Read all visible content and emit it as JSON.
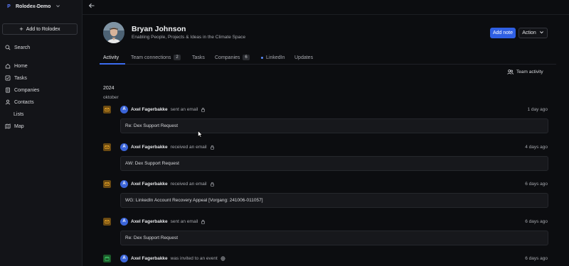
{
  "workspace": {
    "name": "Rolodex-Demo",
    "logo": "P"
  },
  "sidebar": {
    "add_label": "Add to Rolodex",
    "search_label": "Search",
    "items": [
      {
        "label": "Home",
        "icon": "home-icon"
      },
      {
        "label": "Tasks",
        "icon": "check-square-icon"
      },
      {
        "label": "Companies",
        "icon": "building-icon"
      },
      {
        "label": "Contacts",
        "icon": "person-icon"
      },
      {
        "label": "Lists",
        "icon": ""
      },
      {
        "label": "Map",
        "icon": "map-icon"
      }
    ]
  },
  "profile": {
    "name": "Bryan Johnson",
    "tagline": "Enabling People, Projects & Ideas in the Climate Space",
    "add_note_label": "Add note",
    "action_label": "Action"
  },
  "tabs": [
    {
      "label": "Activity",
      "count": ""
    },
    {
      "label": "Team connections",
      "count": "2"
    },
    {
      "label": "Tasks",
      "count": ""
    },
    {
      "label": "Companies",
      "count": "6"
    },
    {
      "label": "LinkedIn",
      "count": ""
    },
    {
      "label": "Updates",
      "count": ""
    }
  ],
  "team_activity_label": "Team activity",
  "timeline": {
    "year": "2024",
    "month": "oktober",
    "activities": [
      {
        "icon": "mail-icon",
        "user_initial": "A",
        "user": "Axel Fagerbakke",
        "verb": "sent an email",
        "visibility": "lock-icon",
        "time": "1 day ago",
        "subject": "Re: Dex Support Request"
      },
      {
        "icon": "mail-icon",
        "user_initial": "A",
        "user": "Axel Fagerbakke",
        "verb": "received an email",
        "visibility": "lock-icon",
        "time": "4 days ago",
        "subject": "AW: Dex Support Request"
      },
      {
        "icon": "mail-icon",
        "user_initial": "A",
        "user": "Axel Fagerbakke",
        "verb": "received an email",
        "visibility": "lock-icon",
        "time": "6 days ago",
        "subject": "WG: LinkedIn Account Recovery Appeal [Vorgang: 241006-011057]"
      },
      {
        "icon": "mail-icon",
        "user_initial": "A",
        "user": "Axel Fagerbakke",
        "verb": "sent an email",
        "visibility": "lock-icon",
        "time": "6 days ago",
        "subject": "Re: Dex Support Request"
      },
      {
        "icon": "calendar-icon",
        "user_initial": "A",
        "user": "Axel Fagerbakke",
        "verb": "was invited to an event",
        "visibility": "globe-icon",
        "time": "6 days ago",
        "subject": ""
      }
    ]
  },
  "colors": {
    "accent": "#2f5fe3",
    "mail_icon_bg": "#6b4a12",
    "mail_icon_fg": "#f0a928",
    "event_icon_bg": "#1c5a2a",
    "event_icon_fg": "#3fcf6a"
  }
}
